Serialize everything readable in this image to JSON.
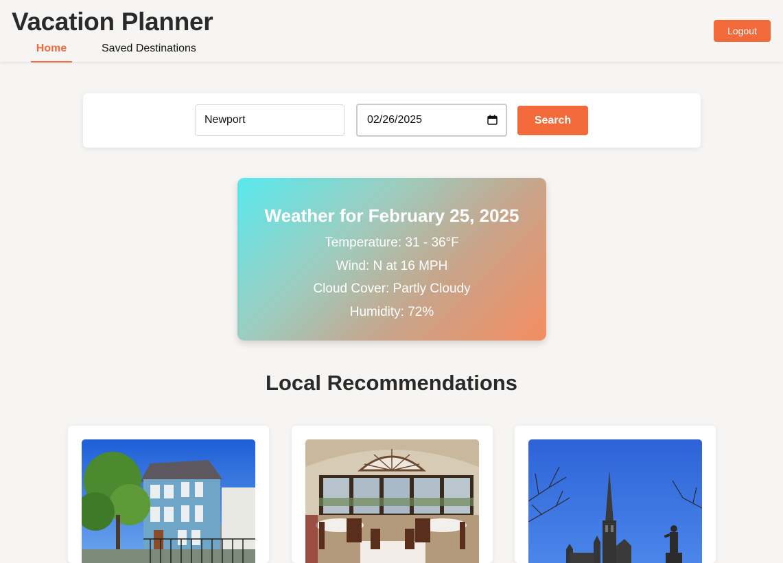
{
  "header": {
    "title": "Vacation Planner",
    "nav": [
      {
        "label": "Home",
        "active": true
      },
      {
        "label": "Saved Destinations",
        "active": false
      }
    ],
    "logout_label": "Logout"
  },
  "search": {
    "city_value": "Newport",
    "date_value": "02/26/2025",
    "button_label": "Search"
  },
  "weather": {
    "title": "Weather for February 25, 2025",
    "temperature": "Temperature: 31 - 36°F",
    "wind": "Wind: N at 16 MPH",
    "cloud_cover": "Cloud Cover: Partly Cloudy",
    "humidity": "Humidity: 72%"
  },
  "recommendations": {
    "heading": "Local Recommendations",
    "cards": [
      {
        "image": "blue-victorian-house-photo"
      },
      {
        "image": "dining-room-ocean-view-photo"
      },
      {
        "image": "church-spire-blue-sky-photo"
      }
    ]
  },
  "colors": {
    "accent": "#f26a3a",
    "background": "#f6f5f3",
    "weather_gradient_start": "#58e8ee",
    "weather_gradient_end": "#f48d60"
  }
}
